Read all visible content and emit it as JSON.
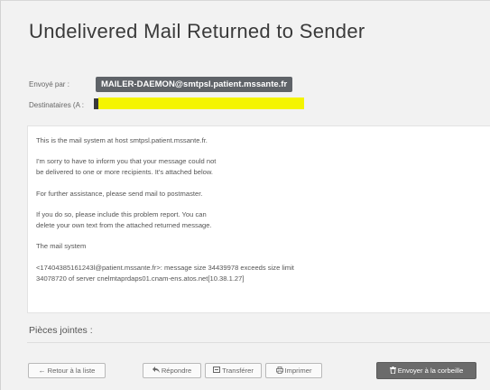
{
  "title": "Undelivered Mail Returned to Sender",
  "from_label": "Envoyé par :",
  "from_value": "MAILER-DAEMON@smtpsl.patient.mssante.fr",
  "to_label": "Destinataires (A :",
  "message_lines": [
    "This is the mail system at host smtpsl.patient.mssante.fr.",
    "I'm sorry to have to inform you that your message could not",
    "be delivered to one or more recipients. It's attached below.",
    "For further assistance, please send mail to postmaster.",
    "If you do so, please include this problem report. You can",
    "delete your own text from the attached returned message.",
    "The mail system",
    "<17404385161243l@patient.mssante.fr>: message size 34439978 exceeds size limit",
    "34078720 of server cnelmtaprdaps01.cnam-ens.atos.net[10.38.1.27]"
  ],
  "attachments_label": "Pièces jointes :",
  "buttons": {
    "back": "Retour à la liste",
    "reply": "Répondre",
    "forward": "Transférer",
    "print": "Imprimer",
    "trash": "Envoyer à la corbeille"
  },
  "icons": {
    "back": "arrow-left-icon",
    "reply": "reply-icon",
    "forward": "forward-icon",
    "print": "printer-icon",
    "trash": "trash-icon"
  },
  "colors": {
    "sender_chip": "#5f6368",
    "redaction": "#f4f400",
    "trash_button": "#6b6b6b"
  }
}
